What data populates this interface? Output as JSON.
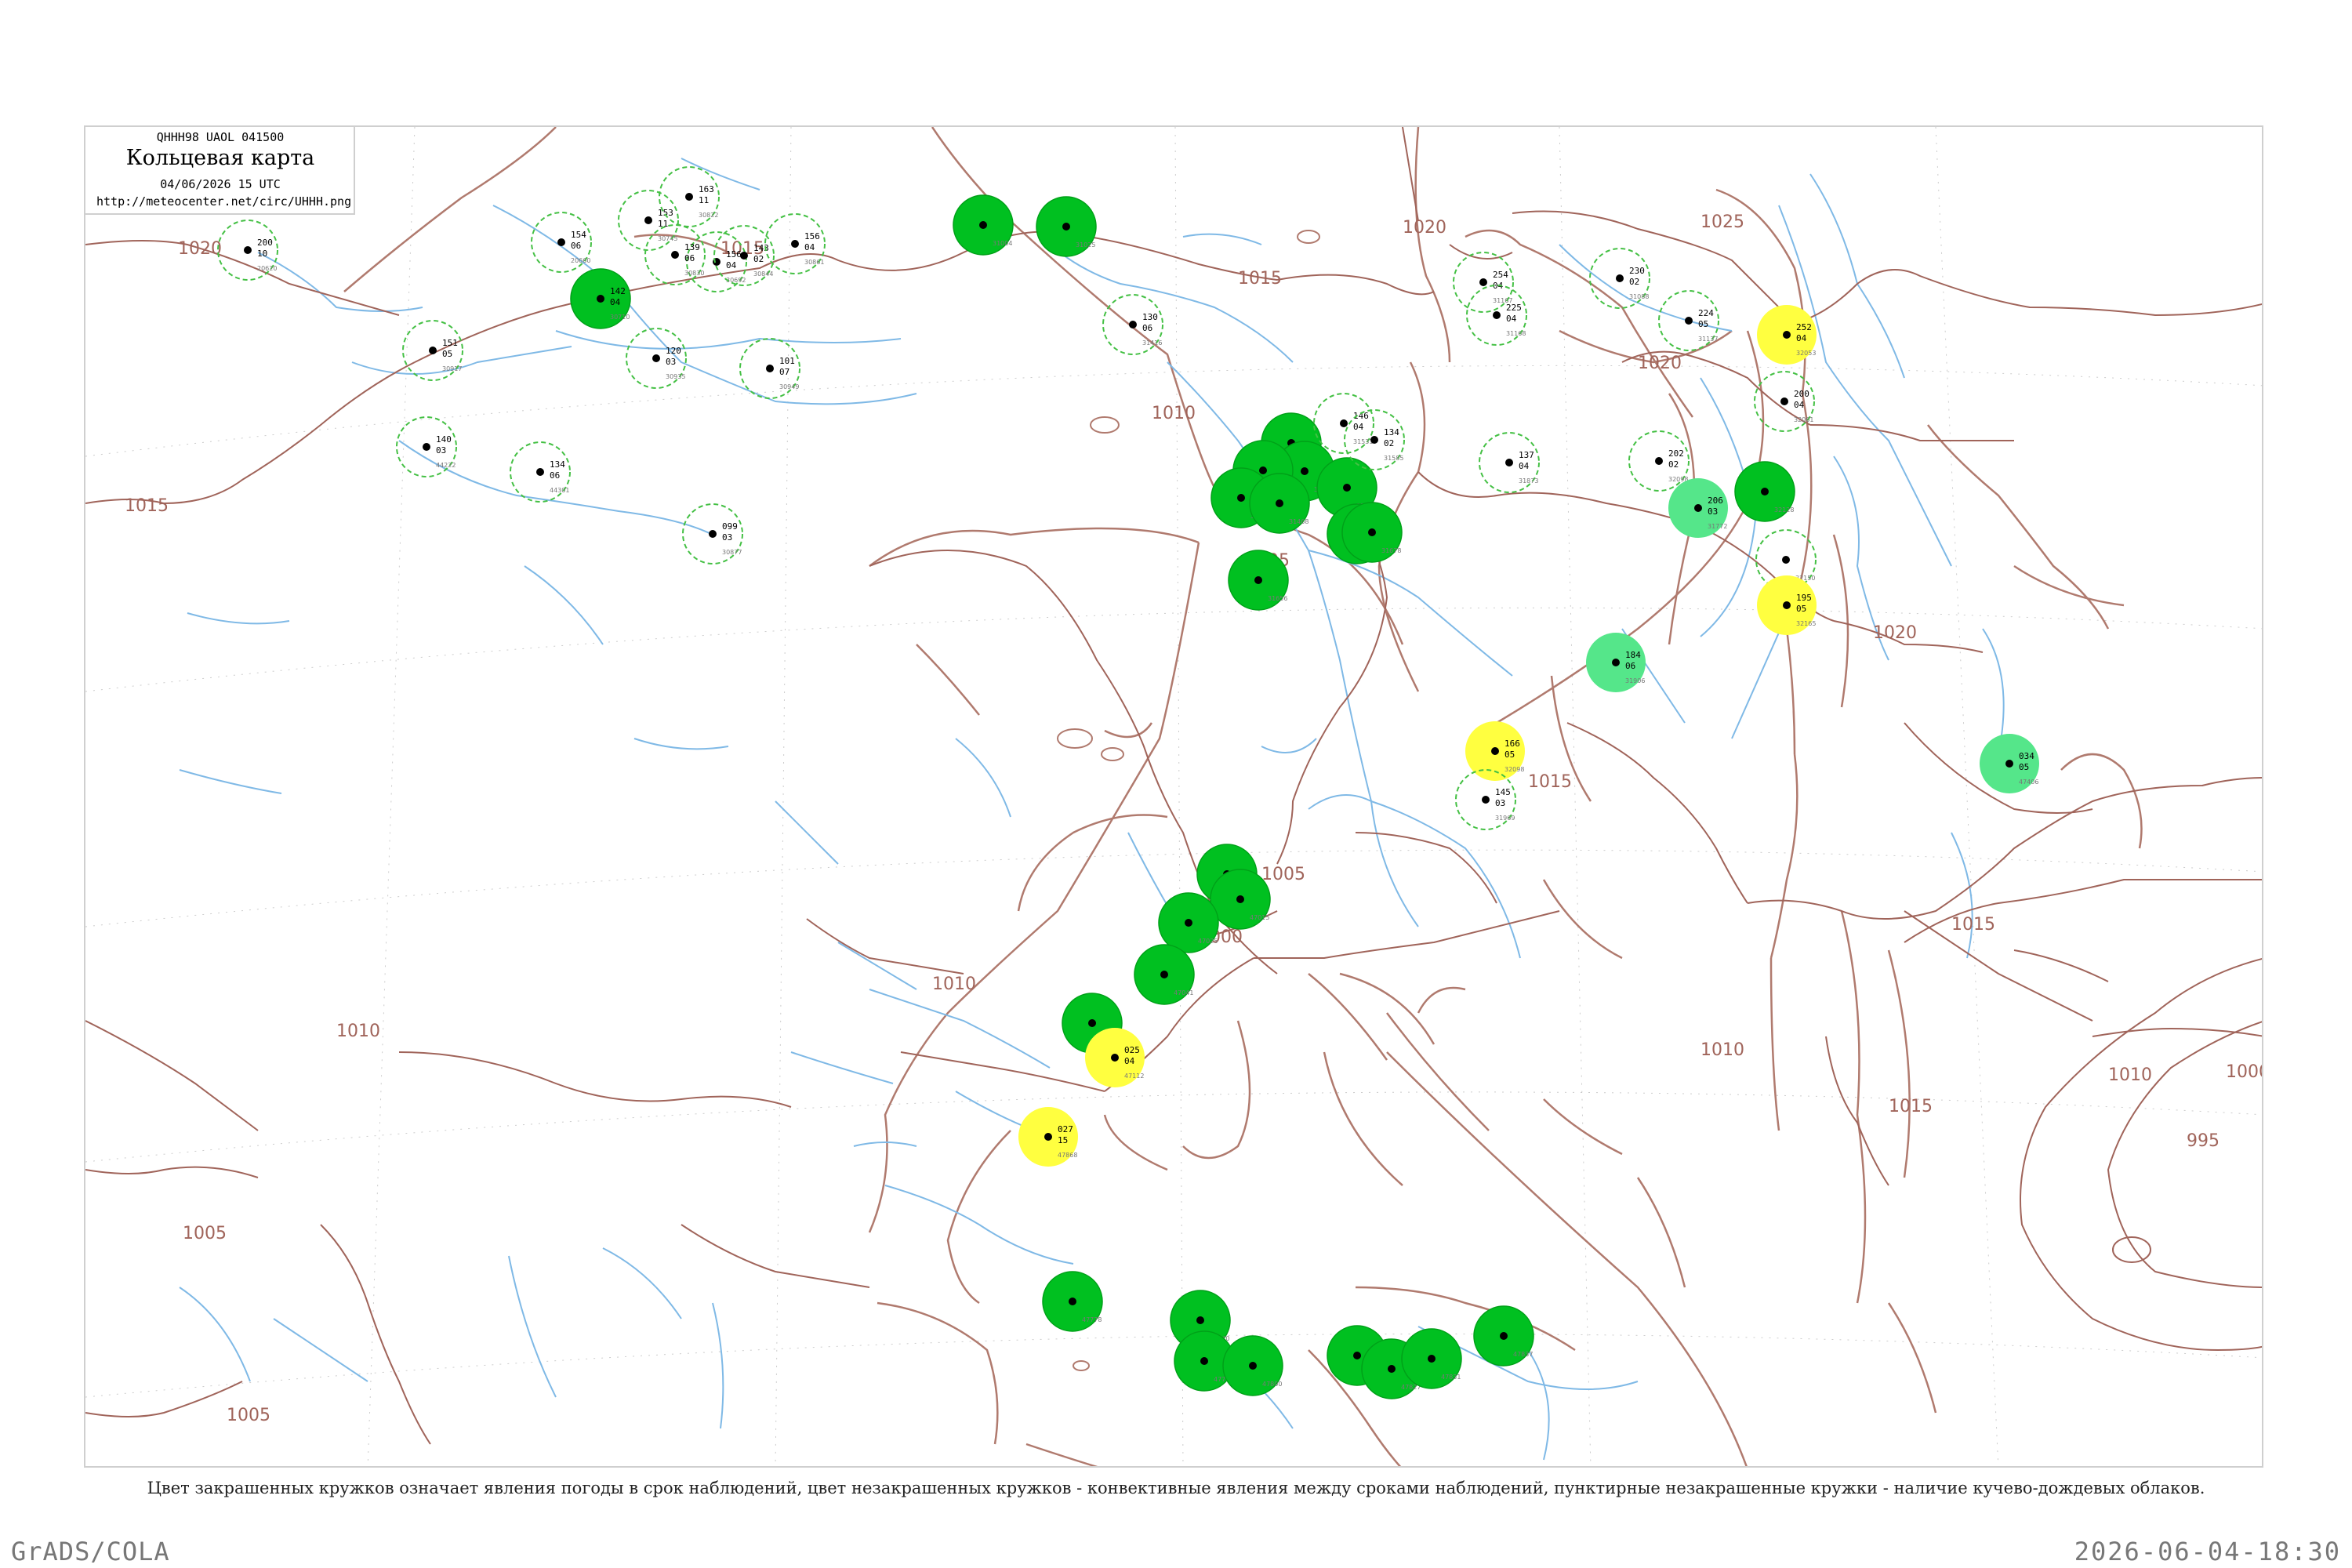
{
  "header": {
    "code": "QHHH98  UAOL  041500",
    "title": "Кольцевая карта",
    "datetime": "04/06/2026 15 UTC",
    "url": "http://meteocenter.net/circ/UHHH.png"
  },
  "legend": {
    "caption": "Цвет закрашенных кружков означает явления погоды в срок наблюдений, цвет незакрашенных кружков - конвективные явления между сроками наблюдений, пунктирные незакрашенные кружки - наличие кучево-дождевых облаков."
  },
  "footer": {
    "software": "GrADS/COLA",
    "generated": "2026-06-04-18:30"
  },
  "colors": {
    "coast": "#b07a6e",
    "river": "#7fb9e6",
    "isobar": "#a0645a",
    "ts_fill": "#00c020",
    "shower_fill": "#55e68a",
    "warn_fill": "#ffff40",
    "cb_dash": "#44c044"
  },
  "isobars": [
    {
      "label": "1020"
    },
    {
      "label": "1015"
    },
    {
      "label": "1015"
    },
    {
      "label": "1020"
    },
    {
      "label": "1025"
    },
    {
      "label": "1020"
    },
    {
      "label": "1015"
    },
    {
      "label": "1010"
    },
    {
      "label": "1005"
    },
    {
      "label": "1000"
    },
    {
      "label": "1005"
    },
    {
      "label": "1010"
    },
    {
      "label": "1005"
    },
    {
      "label": "1005"
    },
    {
      "label": "1010"
    },
    {
      "label": "1015"
    },
    {
      "label": "1020"
    },
    {
      "label": "1015"
    },
    {
      "label": "1010"
    },
    {
      "label": "1000"
    },
    {
      "label": "995"
    },
    {
      "label": "1010"
    },
    {
      "label": "1015"
    }
  ],
  "stations": [
    {
      "kind": "cb",
      "t": "200",
      "p": "10",
      "id": "20620"
    },
    {
      "kind": "cb",
      "t": "154",
      "p": "06",
      "id": "20660"
    },
    {
      "kind": "cb",
      "t": "156",
      "p": "04",
      "id": "30692"
    },
    {
      "kind": "ts",
      "t": "142",
      "p": "04",
      "id": "30710"
    },
    {
      "kind": "cb",
      "t": "153",
      "p": "11",
      "id": "30745"
    },
    {
      "kind": "cb",
      "t": "163",
      "p": "11",
      "id": "30822"
    },
    {
      "kind": "cb",
      "t": "139",
      "p": "06",
      "id": "30830"
    },
    {
      "kind": "cb",
      "t": "143",
      "p": "02",
      "id": "30844"
    },
    {
      "kind": "cb",
      "t": "156",
      "p": "04",
      "id": "30861"
    },
    {
      "kind": "cb",
      "t": "151",
      "p": "05",
      "id": "30917"
    },
    {
      "kind": "cb",
      "t": "120",
      "p": "03",
      "id": "30935"
    },
    {
      "kind": "cb",
      "t": "101",
      "p": "07",
      "id": "30949"
    },
    {
      "kind": "ts",
      "t": "",
      "p": "",
      "id": "31004"
    },
    {
      "kind": "ts",
      "t": "",
      "p": "",
      "id": "31025"
    },
    {
      "kind": "cb",
      "t": "130",
      "p": "06",
      "id": "31416"
    },
    {
      "kind": "ts",
      "t": "",
      "p": "",
      "id": "31439"
    },
    {
      "kind": "ts",
      "t": "",
      "p": "",
      "id": "31443"
    },
    {
      "kind": "ts",
      "t": "",
      "p": "",
      "id": "31453"
    },
    {
      "kind": "ts",
      "t": "",
      "p": "",
      "id": "31445"
    },
    {
      "kind": "ts",
      "t": "",
      "p": "",
      "id": "31468"
    },
    {
      "kind": "cb",
      "t": "146",
      "p": "04",
      "id": "31531"
    },
    {
      "kind": "ts",
      "t": "",
      "p": "",
      "id": "31574"
    },
    {
      "kind": "cb",
      "t": "134",
      "p": "02",
      "id": "31585"
    },
    {
      "kind": "ts",
      "t": "",
      "p": "",
      "id": "31594"
    },
    {
      "kind": "ts",
      "t": "",
      "p": "",
      "id": "31678"
    },
    {
      "kind": "ts",
      "t": "",
      "p": "",
      "id": "31656"
    },
    {
      "kind": "cb",
      "t": "099",
      "p": "03",
      "id": "30877"
    },
    {
      "kind": "cb",
      "t": "140",
      "p": "03",
      "id": "44222"
    },
    {
      "kind": "cb",
      "t": "134",
      "p": "06",
      "id": "44301"
    },
    {
      "kind": "cb",
      "t": "254",
      "p": "04",
      "id": "31167"
    },
    {
      "kind": "cb",
      "t": "225",
      "p": "04",
      "id": "31168"
    },
    {
      "kind": "cb",
      "t": "137",
      "p": "04",
      "id": "31873"
    },
    {
      "kind": "cb",
      "t": "230",
      "p": "02",
      "id": "31088"
    },
    {
      "kind": "cb",
      "t": "224",
      "p": "05",
      "id": "31137"
    },
    {
      "kind": "warn",
      "t": "252",
      "p": "04",
      "id": "32053"
    },
    {
      "kind": "cb",
      "t": "200",
      "p": "04",
      "id": "32061"
    },
    {
      "kind": "cb",
      "t": "202",
      "p": "02",
      "id": "32098"
    },
    {
      "kind": "shower",
      "t": "206",
      "p": "03",
      "id": "31772"
    },
    {
      "kind": "ts",
      "t": "",
      "p": "",
      "id": "32128"
    },
    {
      "kind": "cb",
      "t": "",
      "p": "",
      "id": "32150"
    },
    {
      "kind": "warn",
      "t": "195",
      "p": "05",
      "id": "32165"
    },
    {
      "kind": "shower",
      "t": "184",
      "p": "06",
      "id": "31906"
    },
    {
      "kind": "warn",
      "t": "166",
      "p": "05",
      "id": "32098"
    },
    {
      "kind": "cb",
      "t": "145",
      "p": "03",
      "id": "31969"
    },
    {
      "kind": "shower",
      "t": "034",
      "p": "05",
      "id": "47406"
    },
    {
      "kind": "ts",
      "t": "",
      "p": "",
      "id": "31969"
    },
    {
      "kind": "ts",
      "t": "",
      "p": "",
      "id": "47015"
    },
    {
      "kind": "ts",
      "t": "",
      "p": "",
      "id": "47025"
    },
    {
      "kind": "ts",
      "t": "",
      "p": "",
      "id": "47041"
    },
    {
      "kind": "ts",
      "t": "",
      "p": "",
      "id": "47056"
    },
    {
      "kind": "warn",
      "t": "025",
      "p": "04",
      "id": "47112"
    },
    {
      "kind": "warn",
      "t": "027",
      "p": "15",
      "id": "47868"
    },
    {
      "kind": "ts",
      "t": "",
      "p": "",
      "id": "47778"
    },
    {
      "kind": "ts",
      "t": "",
      "p": "",
      "id": "47740"
    },
    {
      "kind": "ts",
      "t": "",
      "p": "",
      "id": "47790"
    },
    {
      "kind": "ts",
      "t": "",
      "p": "",
      "id": "47800"
    },
    {
      "kind": "ts",
      "t": "",
      "p": "",
      "id": "47809"
    },
    {
      "kind": "ts",
      "t": "",
      "p": "",
      "id": "47827"
    },
    {
      "kind": "ts",
      "t": "",
      "p": "",
      "id": "47831"
    },
    {
      "kind": "ts",
      "t": "",
      "p": "",
      "id": "47837"
    }
  ]
}
